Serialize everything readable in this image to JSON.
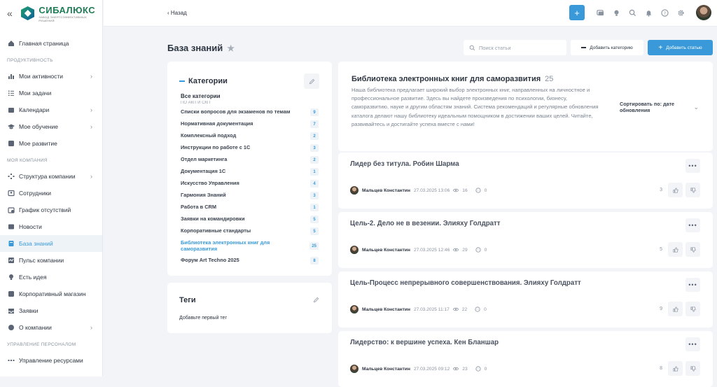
{
  "brand": {
    "name": "СИБАЛЮКС",
    "tagline": "ЗАВОД ЭНЕРГОЭФФЕКТИВНЫХ РЕШЕНИЙ",
    "collapse": "«"
  },
  "nav": {
    "top": [
      {
        "label": "Главная страница",
        "icon": "home-icon"
      }
    ],
    "section1": "ПРОДУКТИВНОСТЬ",
    "group1": [
      {
        "label": "Мои активности",
        "icon": "chart-icon",
        "chevron": true
      },
      {
        "label": "Мои задачи",
        "icon": "list-icon",
        "chevron": false
      },
      {
        "label": "Календари",
        "icon": "calendar-icon",
        "chevron": true
      },
      {
        "label": "Мое обучение",
        "icon": "graduation-icon",
        "chevron": true
      },
      {
        "label": "Мое развитие",
        "icon": "growth-icon",
        "chevron": false
      }
    ],
    "section2": "МОЯ КОМПАНИЯ",
    "group2": [
      {
        "label": "Структура компании",
        "icon": "structure-icon",
        "chevron": true
      },
      {
        "label": "Сотрудники",
        "icon": "people-icon",
        "chevron": false
      },
      {
        "label": "График отсутствий",
        "icon": "schedule-icon",
        "chevron": false
      },
      {
        "label": "Новости",
        "icon": "news-icon",
        "chevron": false
      },
      {
        "label": "База знаний",
        "icon": "book-icon",
        "chevron": false,
        "active": true
      },
      {
        "label": "Пульс компании",
        "icon": "pulse-icon",
        "chevron": false
      },
      {
        "label": "Есть идея",
        "icon": "bulb-icon",
        "chevron": false
      },
      {
        "label": "Корпоративный магазин",
        "icon": "shop-icon",
        "chevron": false
      },
      {
        "label": "Заявки",
        "icon": "inbox-icon",
        "chevron": false
      },
      {
        "label": "О компании",
        "icon": "info-icon",
        "chevron": true
      }
    ],
    "section3": "УПРАВЛЕНИЕ ПЕРСОНАЛОМ",
    "group3": [
      {
        "label": "Управление ресурсами",
        "icon": "resources-icon",
        "chevron": false
      }
    ]
  },
  "topbar": {
    "back": "Назад",
    "add": "+"
  },
  "page": {
    "title": "База знаний"
  },
  "toolbar": {
    "search_placeholder": "Поиск статьи",
    "add_category": "Добавить категорию",
    "add_article": "Добавить статью"
  },
  "categories": {
    "title": "Категории",
    "all": "Все категории",
    "cut": "ПО АКП И СКП",
    "items": [
      {
        "name": "Списки вопросов для экзаменов по темам",
        "count": "9"
      },
      {
        "name": "Нормативная документация",
        "count": "7"
      },
      {
        "name": "Комплексный подход",
        "count": "2"
      },
      {
        "name": "Инструкции по работе с 1С",
        "count": "3"
      },
      {
        "name": "Отдел маркетинга",
        "count": "2"
      },
      {
        "name": "Документация 1С",
        "count": "1"
      },
      {
        "name": "Искусство Управления",
        "count": "4"
      },
      {
        "name": "Гармония Знаний",
        "count": "3"
      },
      {
        "name": "Работа в CRM",
        "count": "1"
      },
      {
        "name": "Заявки на командировки",
        "count": "5"
      },
      {
        "name": "Корпоративные стандарты",
        "count": "5"
      },
      {
        "name": "Библиотека электронных книг для саморазвития",
        "count": "25",
        "selected": true
      },
      {
        "name": "Форум Art Techno 2025",
        "count": "8"
      }
    ]
  },
  "tags": {
    "title": "Теги",
    "empty": "Добавьте первый тег"
  },
  "library": {
    "title": "Библиотека электронных книг для саморазвития",
    "count": "25",
    "description": "Наша библиотека предлагает широкий выбор электронных книг, направленных на личностное и профессиональное развитие. Здесь вы найдете произведения по психологии, бизнесу, саморазвитию, науке и другим областям знаний. Система рекомендаций и регулярные обновления каталога делают нашу библиотеку идеальным помощником в достижении ваших целей. Читайте, развивайтесь и достигайте успеха вместе с нами!",
    "sort": "Сортировать по: дате обновления"
  },
  "articles": [
    {
      "title": "Лидер без титула. Робин Шарма",
      "author": "Мальцев Константин",
      "date": "27.03.2025 13:06",
      "views": "16",
      "comments": "0",
      "likes": "3"
    },
    {
      "title": "Цель-2. Дело не в везении. Элияху Голдратт",
      "author": "Мальцев Константин",
      "date": "27.03.2025 12:46",
      "views": "29",
      "comments": "0",
      "likes": "5"
    },
    {
      "title": "Цель-Процесс непрерывного совершенствования. Элияху Голдратт",
      "author": "Мальцев Константин",
      "date": "27.03.2025 11:17",
      "views": "22",
      "comments": "0",
      "likes": "9"
    },
    {
      "title": "Лидерство: к вершине успеха. Кен Бланшар",
      "author": "Мальцев Константин",
      "date": "27.03.2025 09:12",
      "views": "23",
      "comments": "0",
      "likes": "8"
    }
  ],
  "colors": {
    "accent": "#3a9ad9",
    "brand": "#1e7d55",
    "background": "#f2f4f8"
  }
}
